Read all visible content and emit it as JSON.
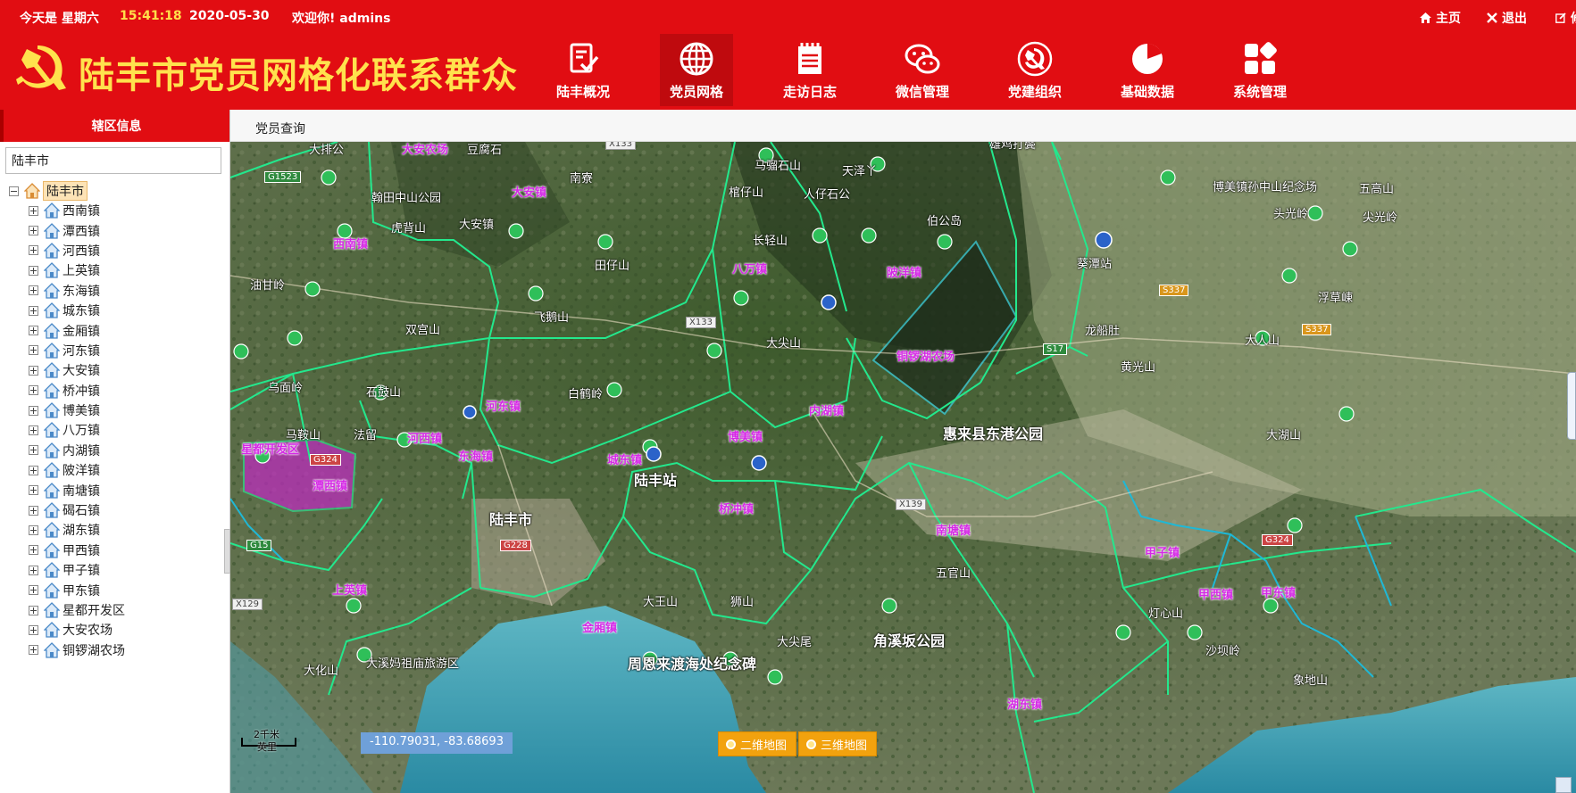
{
  "topbar": {
    "day_prefix": "今天是 星期六",
    "time": "15:41:18",
    "date": "2020-05-30",
    "welcome": "欢迎你! admins",
    "home_label": "主页",
    "logout_label": "退出",
    "modify_label": "修"
  },
  "app": {
    "title": "陆丰市党员网格化联系群众",
    "accent_color": "#e10d12",
    "title_color": "#ffe24d"
  },
  "nav": [
    {
      "label": "陆丰概况",
      "icon": "document-check-icon"
    },
    {
      "label": "党员网格",
      "icon": "globe-icon"
    },
    {
      "label": "走访日志",
      "icon": "notebook-icon"
    },
    {
      "label": "微信管理",
      "icon": "wechat-icon"
    },
    {
      "label": "党建组织",
      "icon": "party-emblem-icon"
    },
    {
      "label": "基础数据",
      "icon": "pie-chart-icon"
    },
    {
      "label": "系统管理",
      "icon": "apps-grid-icon"
    }
  ],
  "nav_active": "党员网格",
  "sidebar": {
    "title": "辖区信息",
    "search_value": "陆丰市",
    "root": "陆丰市",
    "items": [
      "西南镇",
      "潭西镇",
      "河西镇",
      "上英镇",
      "东海镇",
      "城东镇",
      "金厢镇",
      "河东镇",
      "大安镇",
      "桥冲镇",
      "博美镇",
      "八万镇",
      "内湖镇",
      "陂洋镇",
      "南塘镇",
      "碣石镇",
      "湖东镇",
      "甲西镇",
      "甲子镇",
      "甲东镇",
      "星都开发区",
      "大安农场",
      "铜锣湖农场"
    ]
  },
  "tabs": {
    "active": "党员查询"
  },
  "map": {
    "town_labels": [
      "大安农场",
      "大安镇",
      "西南镇",
      "八万镇",
      "陂洋镇",
      "铜锣湖农场",
      "河东镇",
      "内湖镇",
      "星都开发区",
      "潭西镇",
      "河西镇",
      "东海镇",
      "城东镇",
      "博美镇",
      "桥冲镇",
      "南塘镇",
      "甲子镇",
      "甲西镇",
      "甲东镇",
      "上英镇",
      "金厢镇",
      "湖东镇"
    ],
    "place_labels": [
      "大排公",
      "大安农场",
      "豆腐石",
      "翰田中山公园",
      "雄鸡打鬓",
      "马骝石山",
      "天泽丫",
      "伯公岛",
      "大安镇",
      "南寮",
      "棺仔山",
      "人仔石公",
      "陆丰市",
      "陆丰站",
      "惠来县东港公园",
      "葵潭站",
      "大安",
      "长轻山",
      "大尖山",
      "周恩来渡海处纪念碑",
      "大尖尾",
      "角溪坂公园",
      "大化山",
      "大溪妈祖庙旅游区",
      "石鼓山",
      "法留",
      "白鹤岭",
      "虎背山",
      "马鞍山",
      "乌面岭",
      "田仔山",
      "飞鹅山",
      "双宫山",
      "油甘岭",
      "陂洋镇陂洋文化广场",
      "博美镇孙中山纪念场",
      "五高山",
      "青山乡",
      "头光岭",
      "尖光岭",
      "区层崠",
      "浮草崠",
      "大人山",
      "黄光山",
      "龙船肚",
      "五龙山",
      "大湖山",
      "东上",
      "大王山",
      "狮山",
      "虎山",
      "五官山",
      "篮饭山",
      "灯心山",
      "沙坝岭",
      "象地山",
      "海滨山"
    ],
    "road_badges": [
      "X133",
      "G1523",
      "G324",
      "S337",
      "S17",
      "X139",
      "G15",
      "X129",
      "G228",
      "G324",
      "S337",
      "S245",
      "X133"
    ],
    "scale_top": "2千米",
    "scale_bottom": "英里",
    "coord_readout": "-110.79031, -83.68693",
    "mode_2d": "二维地图",
    "mode_3d": "三维地图"
  }
}
